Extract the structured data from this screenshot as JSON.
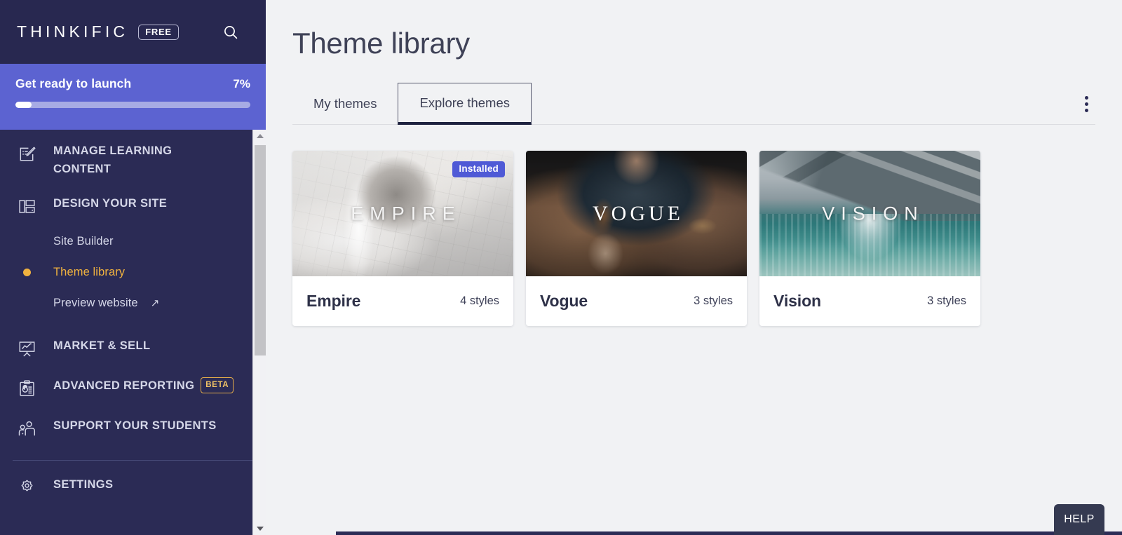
{
  "brand": {
    "name": "THINKIFIC",
    "plan_badge": "FREE",
    "search_icon": "search-icon"
  },
  "launch_panel": {
    "title": "Get ready to launch",
    "percent_label": "7%",
    "percent_value": 7,
    "track_color": "#a7abe4",
    "fill_color": "#ffffff",
    "background": "#5c63d1"
  },
  "sidebar": {
    "background": "#2b2b55",
    "active_color": "#f0b23f",
    "items": [
      {
        "label": "Manage learning content",
        "icon": "note-edit-icon",
        "type": "group",
        "two_line": true
      },
      {
        "label": "Design your site",
        "icon": "layout-panels-icon",
        "type": "group",
        "two_line": false
      },
      {
        "label": "Market & sell",
        "icon": "presentation-chart-icon",
        "type": "group",
        "two_line": false
      },
      {
        "label": "Advanced reporting",
        "icon": "clipboard-chart-icon",
        "type": "group",
        "badge": "BETA",
        "two_line": false
      },
      {
        "label": "Support your students",
        "icon": "people-support-icon",
        "type": "group",
        "two_line": false
      },
      {
        "label": "Settings",
        "icon": "gear-icon",
        "type": "group",
        "two_line": false
      }
    ],
    "sub_items": [
      {
        "label": "Site Builder",
        "active": false,
        "external": false
      },
      {
        "label": "Theme library",
        "active": true,
        "external": false
      },
      {
        "label": "Preview website",
        "active": false,
        "external": true,
        "external_glyph": "↗"
      }
    ]
  },
  "main": {
    "page_title": "Theme library",
    "tabs": [
      {
        "label": "My themes",
        "active": false
      },
      {
        "label": "Explore themes",
        "active": true
      }
    ],
    "overflow_menu_icon": "kebab-menu-icon",
    "themes": [
      {
        "name": "Empire",
        "hero_word": "EMPIRE",
        "styles_label": "4 styles",
        "styles_count": 4,
        "badge": "Installed",
        "hero_style": "empire",
        "word_style": "thin"
      },
      {
        "name": "Vogue",
        "hero_word": "VOGUE",
        "styles_label": "3 styles",
        "styles_count": 3,
        "badge": null,
        "hero_style": "vogue",
        "word_style": "serif"
      },
      {
        "name": "Vision",
        "hero_word": "VISION",
        "styles_label": "3 styles",
        "styles_count": 3,
        "badge": null,
        "hero_style": "vision",
        "word_style": "thin"
      }
    ]
  },
  "help": {
    "label": "HELP"
  },
  "colors": {
    "accent_blue": "#4f5ad6",
    "sidebar_navy": "#2b2b55",
    "highlight_gold": "#f0b23f",
    "canvas": "#f1f2f4"
  }
}
